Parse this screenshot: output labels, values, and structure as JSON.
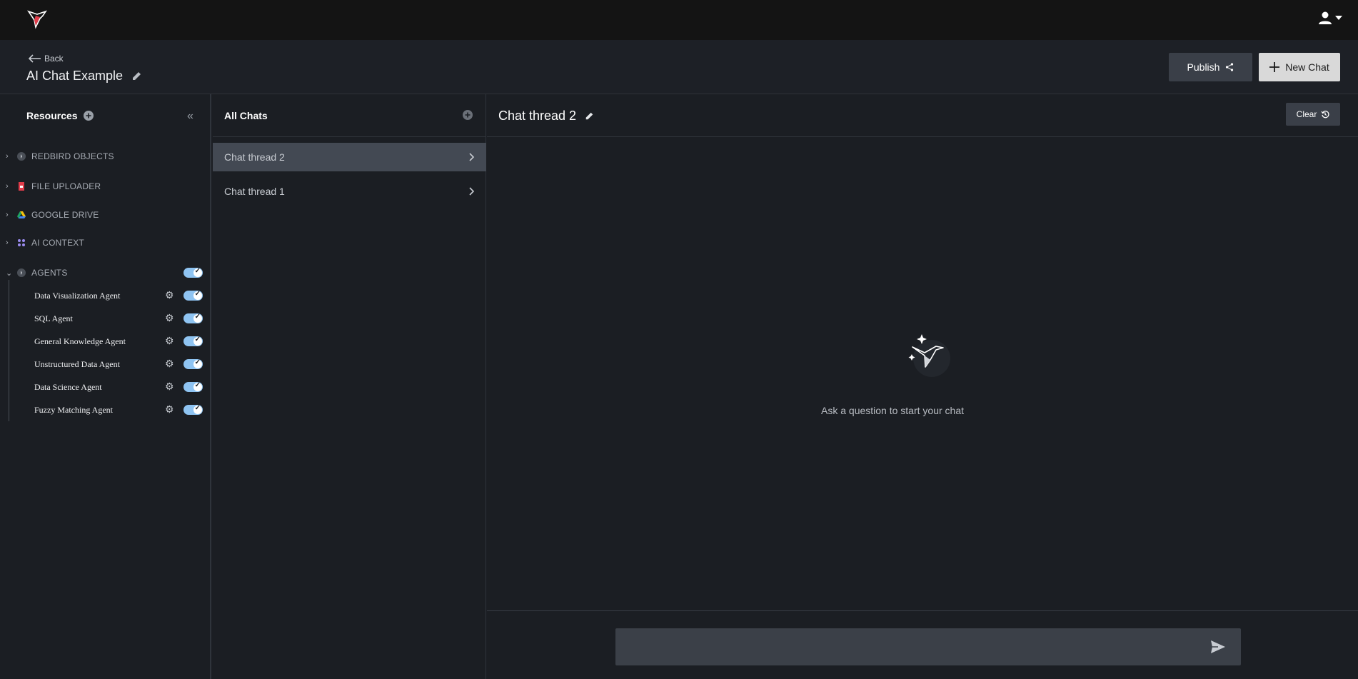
{
  "topbar": {
    "logo": "hummingbird-logo",
    "user_icon": "user-icon"
  },
  "header": {
    "back_label": "Back",
    "title": "AI Chat Example",
    "publish_label": "Publish",
    "new_chat_label": "New Chat"
  },
  "resources": {
    "title": "Resources",
    "groups": [
      {
        "label": "REDBIRD OBJECTS",
        "icon": "redbird-icon"
      },
      {
        "label": "FILE UPLOADER",
        "icon": "file-icon"
      },
      {
        "label": "GOOGLE DRIVE",
        "icon": "google-drive-icon"
      },
      {
        "label": "AI CONTEXT",
        "icon": "ai-context-icon"
      },
      {
        "label": "AGENTS",
        "icon": "agents-icon"
      }
    ],
    "agents": [
      {
        "label": "Data Visualization Agent",
        "enabled": true
      },
      {
        "label": "SQL Agent",
        "enabled": true
      },
      {
        "label": "General Knowledge Agent",
        "enabled": true
      },
      {
        "label": "Unstructured Data Agent",
        "enabled": true
      },
      {
        "label": "Data Science Agent",
        "enabled": true
      },
      {
        "label": "Fuzzy Matching Agent",
        "enabled": true
      }
    ]
  },
  "chats": {
    "title": "All Chats",
    "threads": [
      {
        "label": "Chat thread 2",
        "active": true
      },
      {
        "label": "Chat thread 1",
        "active": false
      }
    ]
  },
  "main": {
    "title": "Chat thread 2",
    "clear_label": "Clear",
    "empty_text": "Ask a question to start your chat",
    "composer_placeholder": ""
  },
  "colors": {
    "accent_toggle": "#8fc4f2",
    "active_thread": "#434953",
    "brand_red": "#e03c4a"
  }
}
